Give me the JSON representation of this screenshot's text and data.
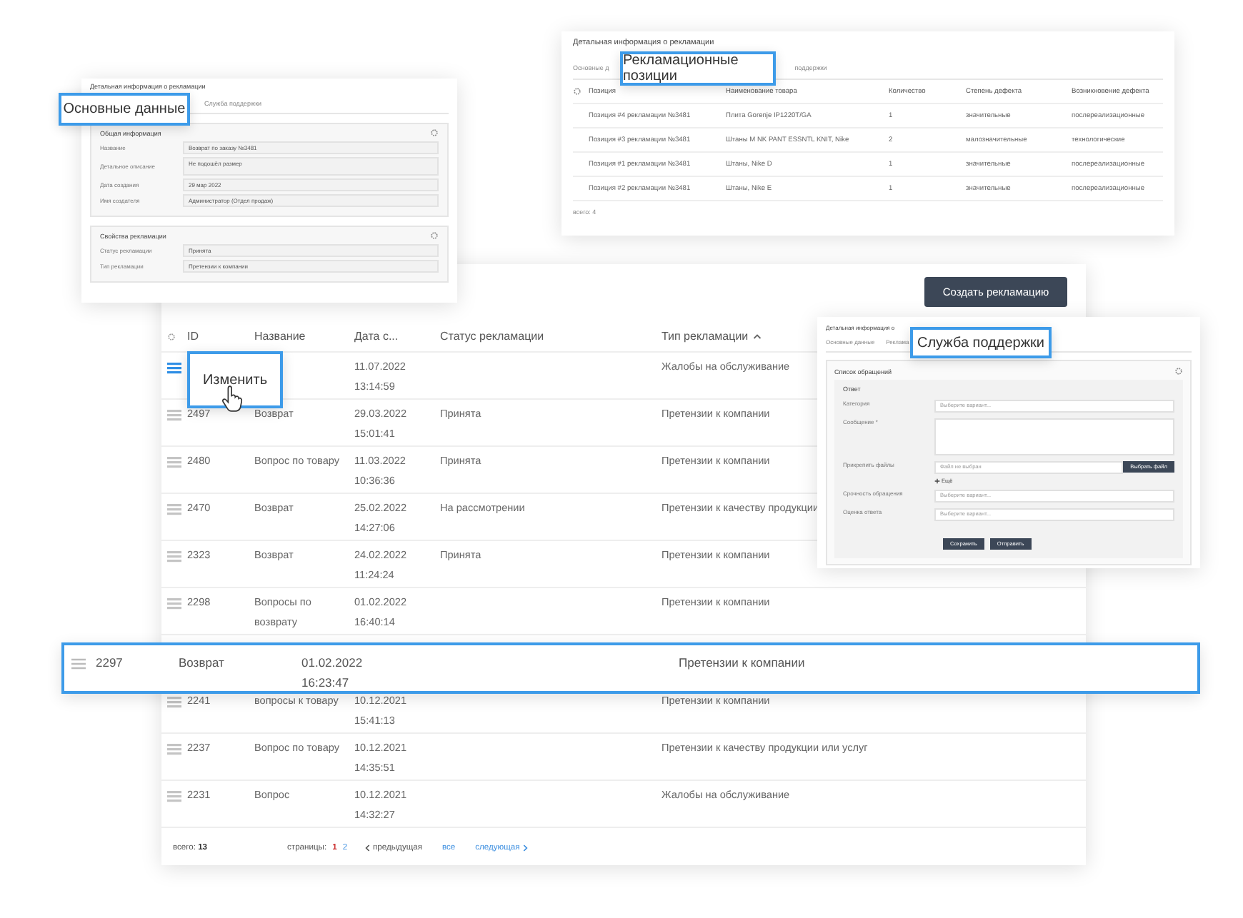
{
  "basic_card": {
    "title": "Детальная информация о рекламации",
    "callout": "Основные данные",
    "tabs": [
      {
        "label": "Служба поддержки",
        "selected": false
      }
    ],
    "sections": [
      {
        "title": "Общая информация",
        "fields": [
          {
            "label": "Название",
            "value": "Возврат по заказу №3481",
            "kind": "input"
          },
          {
            "label": "Детальное описание",
            "value": "Не подошёл размер",
            "kind": "textarea"
          },
          {
            "label": "Дата создания",
            "value": "29 мар 2022",
            "kind": "input"
          },
          {
            "label": "Имя создателя",
            "value": "Администратор (Отдел продаж)",
            "kind": "input"
          }
        ]
      },
      {
        "title": "Свойства рекламации",
        "fields": [
          {
            "label": "Статус рекламации",
            "value": "Принята",
            "kind": "input"
          },
          {
            "label": "Тип рекламации",
            "value": "Претензии к компании",
            "kind": "input"
          }
        ]
      }
    ]
  },
  "positions_card": {
    "title": "Детальная информация о рекламации",
    "callout": "Рекламационные позиции",
    "tabs": [
      {
        "label": "Основные д",
        "selected": false
      },
      {
        "label": "поддержки",
        "selected": false
      }
    ],
    "columns": [
      "Позиция",
      "Наименование товара",
      "Количество",
      "Степень дефекта",
      "Возникновение дефекта"
    ],
    "rows": [
      [
        "Позиция #4 рекламации №3481",
        "Плита Gorenje IP1220T/GA",
        "1",
        "значительные",
        "послереализационные"
      ],
      [
        "Позиция #3 рекламации №3481",
        "Штаны M NK PANT ESSNTL KNIT, Nike",
        "2",
        "малозначительные",
        "технологические"
      ],
      [
        "Позиция #1 рекламации №3481",
        "Штаны, Nike D",
        "1",
        "значительные",
        "послереализационные"
      ],
      [
        "Позиция #2 рекламации №3481",
        "Штаны, Nike E",
        "1",
        "значительные",
        "послереализационные"
      ]
    ],
    "total": "всего: 4"
  },
  "claims": {
    "create_button": "Создать рекламацию",
    "columns": [
      {
        "label": "ID",
        "sorted": false
      },
      {
        "label": "Название",
        "sorted": false
      },
      {
        "label": "Дата с...",
        "sorted": false
      },
      {
        "label": "Статус рекламации",
        "sorted": false
      },
      {
        "label": "Тип рекламации",
        "sorted": true
      }
    ],
    "rows": [
      {
        "kind": "row",
        "selected": true,
        "date": "11.07.2022",
        "time": "13:14:59",
        "type": "Жалобы на обслуживание"
      },
      {
        "kind": "row",
        "selected": false,
        "id": "2497",
        "name": "Возврат",
        "date": "29.03.2022",
        "time": "15:01:41",
        "status": "Принята",
        "type": "Претензии к компании"
      },
      {
        "kind": "row",
        "selected": false,
        "id": "2480",
        "name": "Вопрос по товару",
        "date": "11.03.2022",
        "time": "10:36:36",
        "status": "Принята",
        "type": "Претензии к компании"
      },
      {
        "kind": "row",
        "selected": false,
        "id": "2470",
        "name": "Возврат",
        "date": "25.02.2022",
        "time": "14:27:06",
        "status": "На рассмотрении",
        "type": "Претензии к качеству продукции"
      },
      {
        "kind": "row",
        "selected": false,
        "id": "2323",
        "name": "Возврат",
        "date": "24.02.2022",
        "time": "11:24:24",
        "status": "Принята",
        "type": "Претензии к компании"
      },
      {
        "kind": "row",
        "selected": false,
        "id": "2298",
        "name": "Вопросы по возврату",
        "date": "01.02.2022",
        "time": "16:40:14",
        "status": "",
        "type": "Претензии к компании"
      },
      {
        "kind": "gap"
      },
      {
        "kind": "row",
        "selected": false,
        "id": "2241",
        "name": "вопросы к товару",
        "date": "10.12.2021",
        "time": "15:41:13",
        "status": "",
        "type": "Претензии к компании"
      },
      {
        "kind": "row",
        "selected": false,
        "id": "2237",
        "name": "Вопрос по товару",
        "date": "10.12.2021",
        "time": "14:35:51",
        "status": "",
        "type": "Претензии к качеству продукции или услуг"
      },
      {
        "kind": "row",
        "selected": false,
        "id": "2231",
        "name": "Вопрос",
        "date": "10.12.2021",
        "time": "14:32:27",
        "status": "",
        "type": "Жалобы на обслуживание"
      }
    ],
    "zoomed_row": {
      "id": "2297",
      "name": "Возврат",
      "date": "01.02.2022",
      "time": "16:23:47",
      "type": "Претензии к компании"
    },
    "menu_callout": "Изменить",
    "total_label": "всего:",
    "total": "13",
    "pages_label": "страницы:",
    "pages": [
      {
        "label": "1",
        "selected": true
      },
      {
        "label": "2",
        "selected": false
      }
    ],
    "prev": "предыдущая",
    "all": "все",
    "next": "следующая"
  },
  "support_card": {
    "title": "Детальная информация о",
    "callout": "Служба поддержки",
    "tabs": [
      {
        "label": "Основные данные",
        "selected": false
      },
      {
        "label": "Реклама",
        "selected": false
      }
    ],
    "panel_title": "Список обращений",
    "form_title": "Ответ",
    "fields": [
      {
        "label": "Категория",
        "kind": "select",
        "placeholder": "Выберите вариант..."
      },
      {
        "label": "Сообщение *",
        "kind": "textarea"
      },
      {
        "label": "Прикрепить файлы",
        "kind": "file",
        "placeholder": "Файл не выбран",
        "button": "Выбрать файл",
        "more": "Ещё"
      },
      {
        "label": "Срочность обращения",
        "kind": "select",
        "placeholder": "Выберите вариант..."
      },
      {
        "label": "Оценка ответа",
        "kind": "select",
        "placeholder": "Выберите вариант..."
      }
    ],
    "buttons": [
      "Сохранить",
      "Отправить"
    ]
  }
}
